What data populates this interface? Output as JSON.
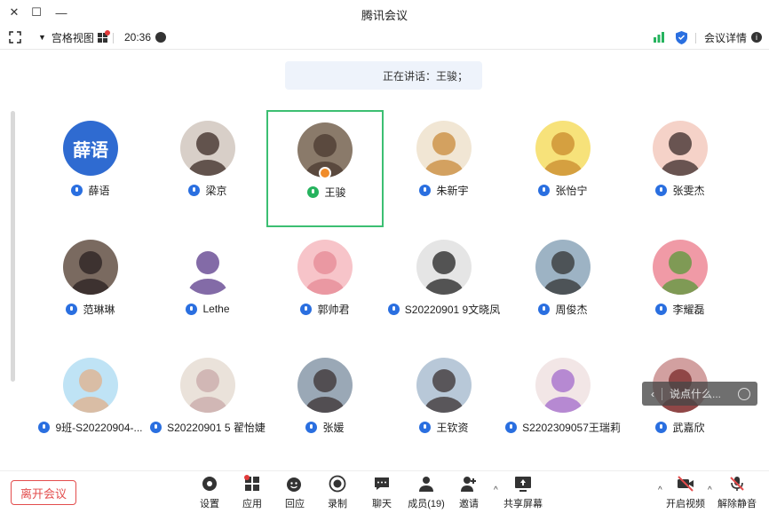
{
  "window": {
    "title": "腾讯会议"
  },
  "infobar": {
    "view_mode": "宫格视图",
    "timer": "20:36",
    "meeting_details": "会议详情"
  },
  "banner": {
    "speaking": "正在讲话：王骏；"
  },
  "participants": [
    {
      "name": "张雯杰",
      "avatar_text": ""
    },
    {
      "name": "张怡宁",
      "avatar_text": ""
    },
    {
      "name": "朱新宇",
      "avatar_text": ""
    },
    {
      "name": "王骏",
      "avatar_text": ""
    },
    {
      "name": "梁京",
      "avatar_text": ""
    },
    {
      "name": "薛语",
      "avatar_text": "薛语"
    },
    {
      "name": "李耀磊",
      "avatar_text": ""
    },
    {
      "name": "周俊杰",
      "avatar_text": ""
    },
    {
      "name": "S20220901 9文晓凤",
      "avatar_text": ""
    },
    {
      "name": "郭帅君",
      "avatar_text": ""
    },
    {
      "name": "Lethe",
      "avatar_text": ""
    },
    {
      "name": "范琳琳",
      "avatar_text": ""
    },
    {
      "name": "武嘉欣",
      "avatar_text": ""
    },
    {
      "name": "S2202309057王瑞莉",
      "avatar_text": ""
    },
    {
      "name": "王钦资",
      "avatar_text": ""
    },
    {
      "name": "张媛",
      "avatar_text": ""
    },
    {
      "name": "S20220901 5 翟怡婕",
      "avatar_text": ""
    },
    {
      "name": "9班-S20220904-...",
      "avatar_text": ""
    }
  ],
  "chat_float": {
    "label": "说点什么..."
  },
  "toolbar": {
    "leave": "离开会议",
    "unmute": "解除静音",
    "start_video": "开启视频",
    "share_screen": "共享屏幕",
    "invite": "邀请",
    "members": "成员(19)",
    "chat": "聊天",
    "record": "录制",
    "reactions": "回应",
    "apps": "应用",
    "settings": "设置"
  },
  "colors": {
    "accent": "#2a6fe0",
    "active_border": "#3cbf72",
    "danger": "#e34d4d"
  }
}
